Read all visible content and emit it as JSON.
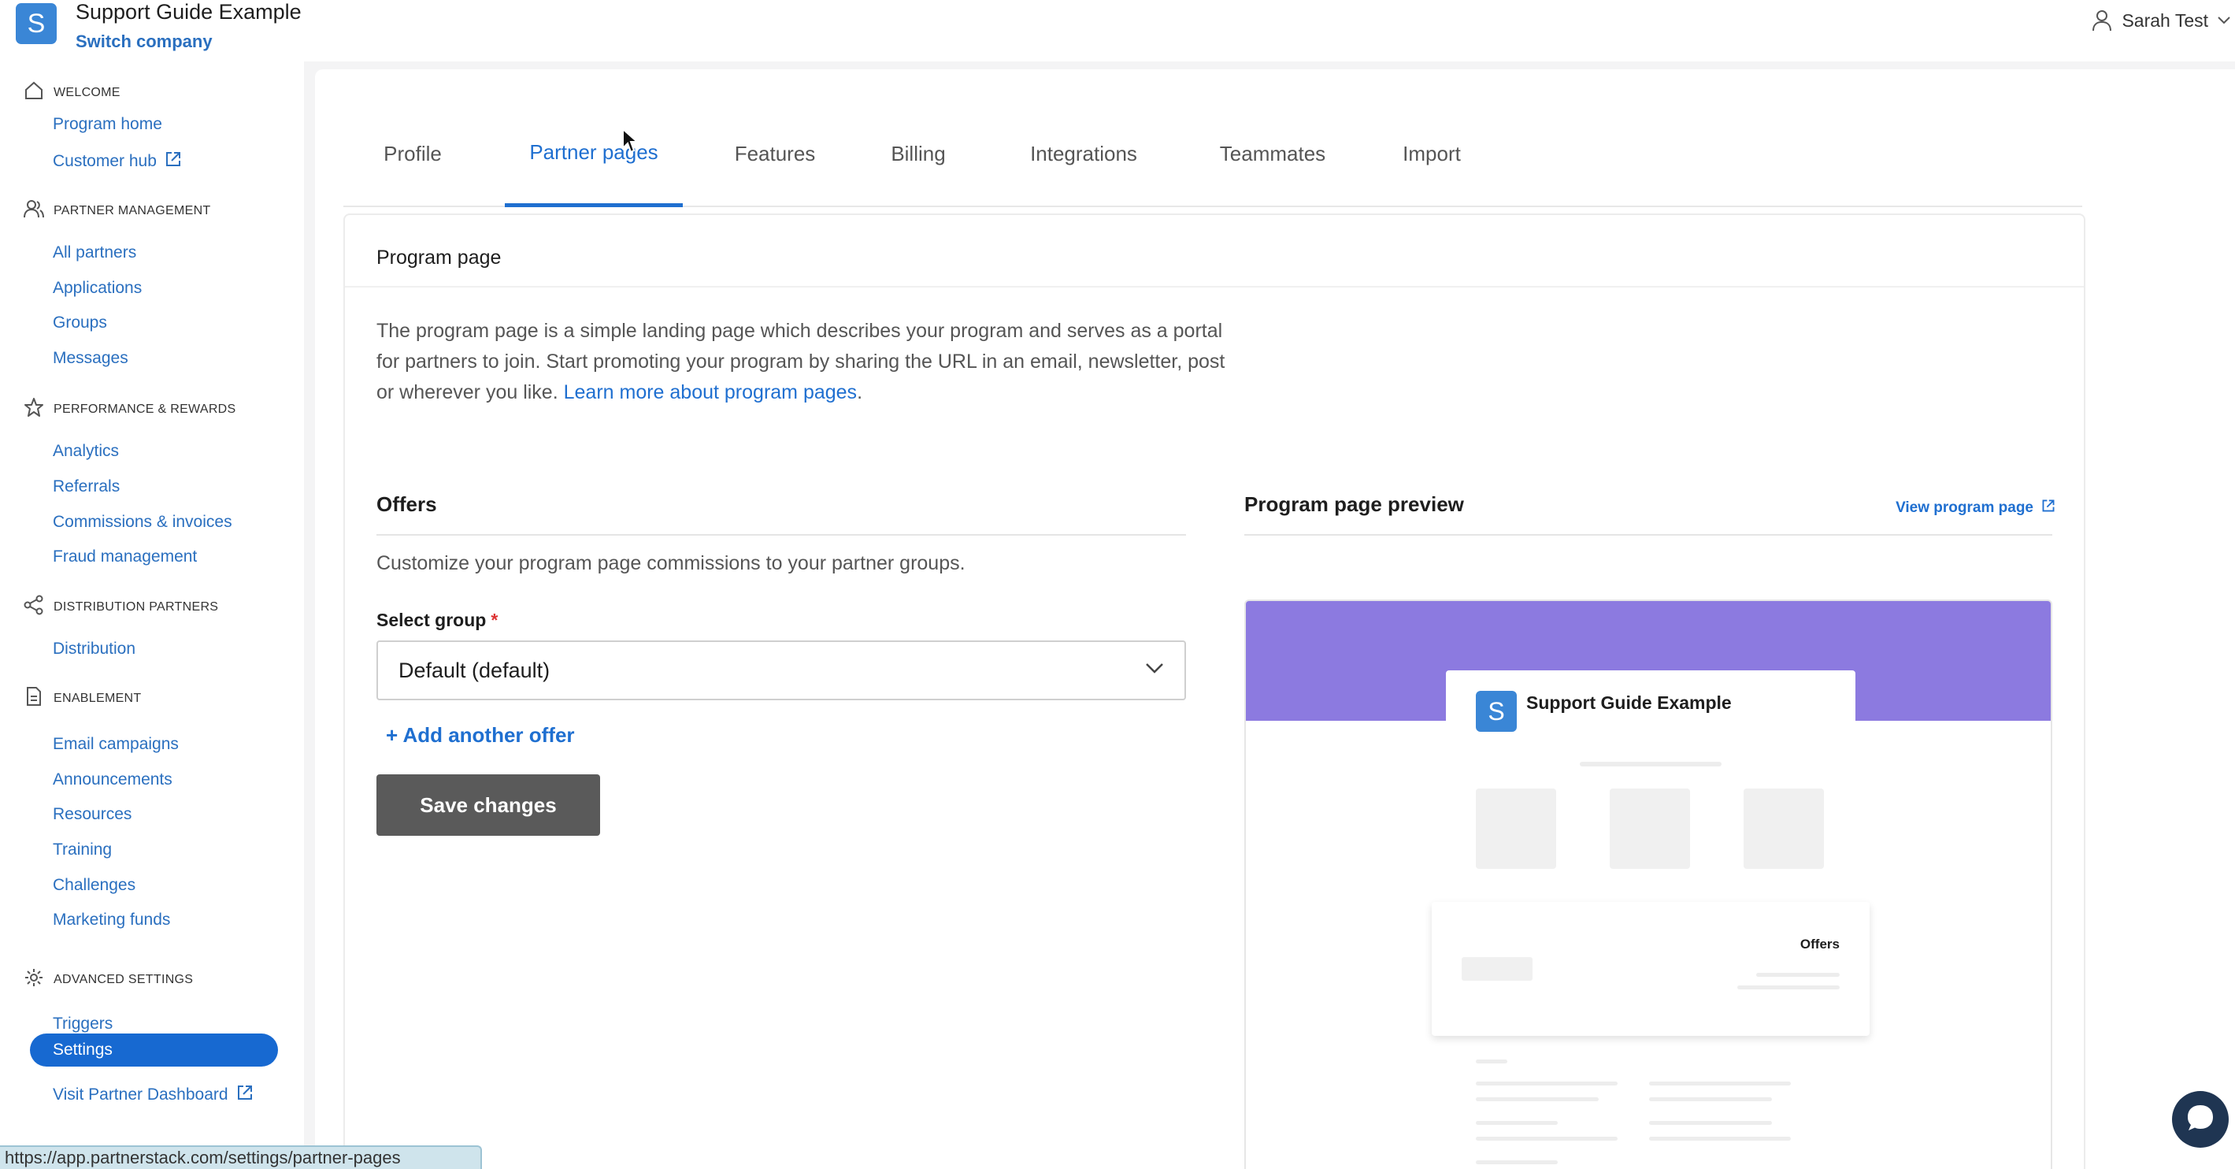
{
  "header": {
    "logo_letter": "S",
    "company_name": "Support Guide Example",
    "switch_company": "Switch company",
    "user_name": "Sarah Test",
    "user_icon": "user-icon",
    "brand_color": "#3a86d6"
  },
  "sidebar": {
    "sections": [
      {
        "title": "WELCOME",
        "icon": "home-icon",
        "items": [
          "Program home",
          "Customer hub"
        ]
      },
      {
        "title": "PARTNER MANAGEMENT",
        "icon": "users-icon",
        "items": [
          "All partners",
          "Applications",
          "Groups",
          "Messages"
        ]
      },
      {
        "title": "PERFORMANCE & REWARDS",
        "icon": "star-icon",
        "items": [
          "Analytics",
          "Referrals",
          "Commissions & invoices",
          "Fraud management"
        ]
      },
      {
        "title": "DISTRIBUTION PARTNERS",
        "icon": "share-icon",
        "items": [
          "Distribution"
        ]
      },
      {
        "title": "ENABLEMENT",
        "icon": "document-icon",
        "items": [
          "Email campaigns",
          "Announcements",
          "Resources",
          "Training",
          "Challenges",
          "Marketing funds"
        ]
      },
      {
        "title": "ADVANCED SETTINGS",
        "icon": "gear-icon",
        "items": [
          "Triggers",
          "Settings",
          "Visit Partner Dashboard"
        ]
      }
    ],
    "active_item": "Settings",
    "active_color": "#1769d1"
  },
  "tabs": [
    {
      "label": "Profile",
      "active": false
    },
    {
      "label": "Partner pages",
      "active": true
    },
    {
      "label": "Features",
      "active": false
    },
    {
      "label": "Billing",
      "active": false
    },
    {
      "label": "Integrations",
      "active": false
    },
    {
      "label": "Teammates",
      "active": false
    },
    {
      "label": "Import",
      "active": false
    }
  ],
  "program_page": {
    "title": "Program page",
    "description": "The program page is a simple landing page which describes your program and serves as a portal for partners to join. Start promoting your program by sharing the URL in an email, newsletter, post or wherever you like.",
    "learn_more": "Learn more about program pages",
    "offers": {
      "title": "Offers",
      "description": "Customize your program page commissions to your partner groups.",
      "select_label": "Select group",
      "required_marker": "*",
      "selected_group": "Default (default)",
      "add_offer": "+ Add another offer",
      "save_button": "Save changes"
    },
    "preview": {
      "title": "Program page preview",
      "view_link": "View program page",
      "company_name": "Support Guide Example",
      "logo_letter": "S",
      "offers_label": "Offers",
      "banner_color": "#8c7ae0"
    }
  },
  "status_bar": {
    "url": "https://app.partnerstack.com/settings/partner-pages"
  }
}
